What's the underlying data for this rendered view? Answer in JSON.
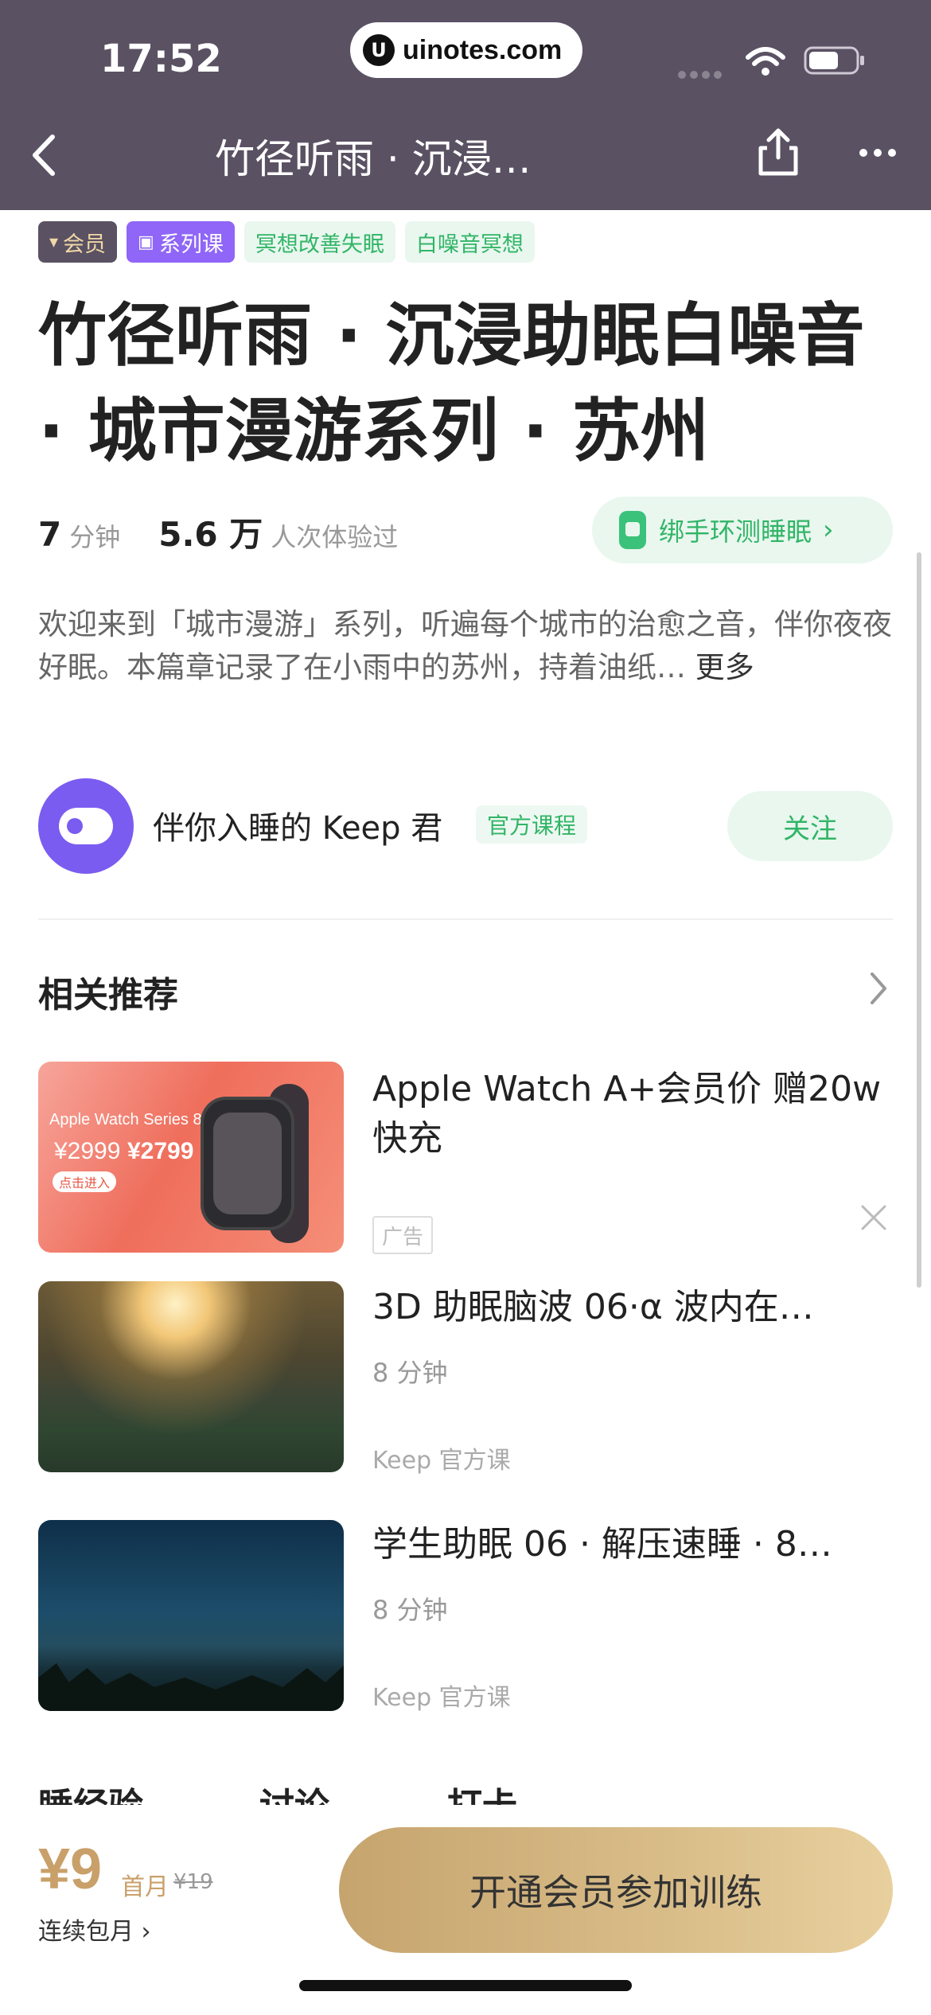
{
  "status_bar": {
    "time": "17:52",
    "url": "uinotes.com",
    "url_logo": "U"
  },
  "nav": {
    "title": "竹径听雨 · 沉浸…"
  },
  "tags": [
    {
      "label": "会员",
      "icon": "diamond-icon"
    },
    {
      "label": "系列课",
      "icon": "play-icon"
    },
    {
      "label": "冥想改善失眠"
    },
    {
      "label": "白噪音冥想"
    }
  ],
  "title": "竹径听雨 · 沉浸助眠白噪音 · 城市漫游系列 · 苏州",
  "meta": {
    "duration_value": "7",
    "duration_unit": "分钟",
    "plays_value": "5.6 万",
    "plays_unit": "人次体验过",
    "band_button": "绑手环测睡眠"
  },
  "description": {
    "text": "欢迎来到「城市漫游」系列，听遍每个城市的治愈之音，伴你夜夜好眠。本篇章记录了在小雨中的苏州，持着油纸…",
    "more": "更多"
  },
  "author": {
    "name": "伴你入睡的 Keep 君",
    "tag": "官方课程",
    "follow": "关注"
  },
  "related": {
    "heading": "相关推荐",
    "ad": {
      "title": "Apple Watch A+会员价 赠20w快充",
      "tag": "广告",
      "image": {
        "series": "Apple Watch Series 8",
        "price_a": "¥2999",
        "price_b": "¥2799",
        "badge": "点击进入"
      }
    },
    "items": [
      {
        "title": "3D 助眠脑波 06·α 波内在…",
        "duration": "8 分钟",
        "source": "Keep 官方课"
      },
      {
        "title": "学生助眠 06 · 解压速睡 · 8…",
        "duration": "8 分钟",
        "source": "Keep 官方课"
      }
    ]
  },
  "tabs_cut": [
    "睡经验",
    "讨论",
    "打卡"
  ],
  "bottom": {
    "price": "¥9",
    "first_month": "首月",
    "old_price": "¥19",
    "renew": "连续包月 ›",
    "cta": "开通会员参加训练"
  },
  "colors": {
    "nav_bg": "#5a5163",
    "accent_green": "#31b566",
    "accent_gold": "#c9a06a",
    "series_purple": "#8f66f7"
  }
}
